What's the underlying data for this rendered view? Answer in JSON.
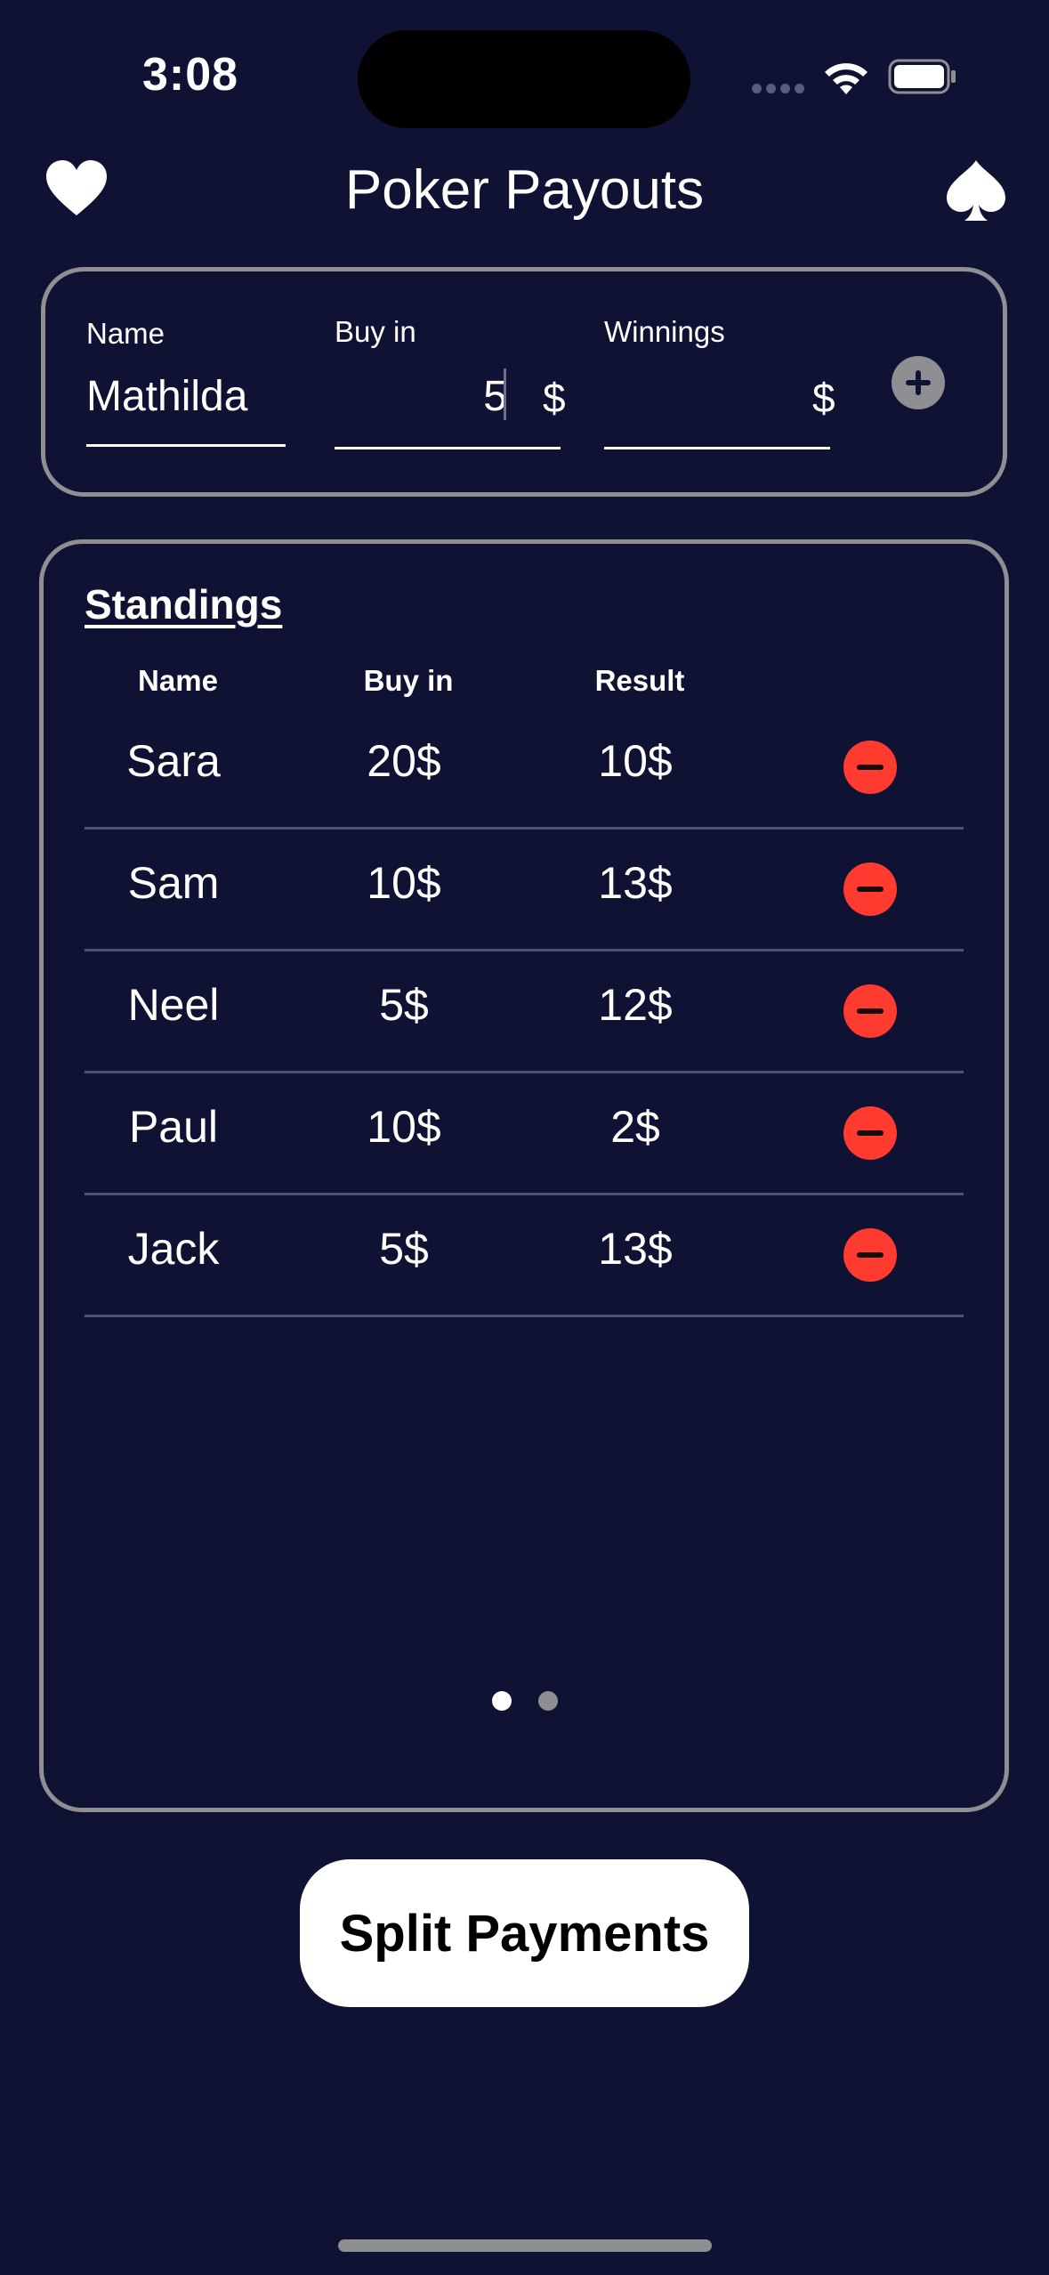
{
  "status_bar": {
    "time": "3:08"
  },
  "header": {
    "title": "Poker Payouts",
    "left_icon": "heart-icon",
    "right_icon": "spade-icon"
  },
  "input": {
    "name_label": "Name",
    "name_value": "Mathilda",
    "buyin_label": "Buy in",
    "buyin_value": "5",
    "buyin_currency": "$",
    "winnings_label": "Winnings",
    "winnings_value": "",
    "winnings_currency": "$",
    "add_icon": "plus-circle-icon"
  },
  "standings": {
    "title": "Standings",
    "columns": [
      "Name",
      "Buy in",
      "Result"
    ],
    "rows": [
      {
        "name": "Sara",
        "buyin": "20$",
        "result": "10$"
      },
      {
        "name": "Sam",
        "buyin": "10$",
        "result": "13$"
      },
      {
        "name": "Neel",
        "buyin": "5$",
        "result": "12$"
      },
      {
        "name": "Paul",
        "buyin": "10$",
        "result": "2$"
      },
      {
        "name": "Jack",
        "buyin": "5$",
        "result": "13$"
      }
    ],
    "remove_icon": "minus-circle-icon",
    "page_indicator": {
      "pages": 2,
      "current": 1
    }
  },
  "actions": {
    "split_label": "Split Payments"
  },
  "colors": {
    "background": "#101233",
    "border": "#8e8e93",
    "remove": "#ff3b30",
    "button": "#ffffff"
  }
}
